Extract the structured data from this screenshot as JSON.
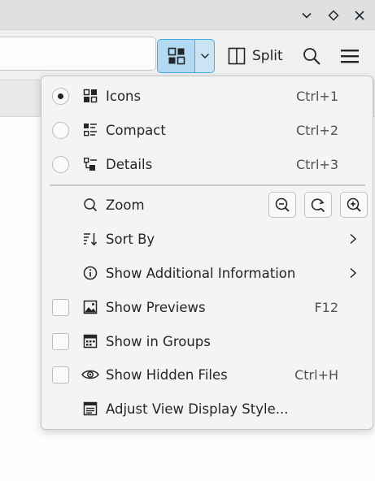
{
  "window": {
    "buttons": [
      {
        "name": "minimize",
        "icon": "chevron-down-icon"
      },
      {
        "name": "maximize",
        "icon": "diamond-icon"
      },
      {
        "name": "close",
        "icon": "close-icon"
      }
    ]
  },
  "toolbar": {
    "split_label": "Split",
    "view_mode_icon": "icons-view-icon",
    "search_icon": "search-icon",
    "menu_icon": "hamburger-menu-icon"
  },
  "menu": {
    "view_modes": [
      {
        "label": "Icons",
        "shortcut": "Ctrl+1",
        "checked": true,
        "icon": "icons-view-icon"
      },
      {
        "label": "Compact",
        "shortcut": "Ctrl+2",
        "checked": false,
        "icon": "compact-view-icon"
      },
      {
        "label": "Details",
        "shortcut": "Ctrl+3",
        "checked": false,
        "icon": "details-view-icon"
      }
    ],
    "zoom": {
      "label": "Zoom",
      "icon": "zoom-icon",
      "buttons": [
        "zoom-out-icon",
        "zoom-reset-icon",
        "zoom-in-icon"
      ]
    },
    "sort_by": {
      "label": "Sort By",
      "icon": "sort-icon"
    },
    "additional_info": {
      "label": "Show Additional Information",
      "icon": "info-icon"
    },
    "toggles": [
      {
        "label": "Show Previews",
        "shortcut": "F12",
        "checked": false,
        "icon": "image-icon"
      },
      {
        "label": "Show in Groups",
        "shortcut": "",
        "checked": false,
        "icon": "groups-icon"
      },
      {
        "label": "Show Hidden Files",
        "shortcut": "Ctrl+H",
        "checked": false,
        "icon": "eye-icon"
      }
    ],
    "adjust": {
      "label": "Adjust View Display Style...",
      "icon": "display-style-icon"
    }
  }
}
